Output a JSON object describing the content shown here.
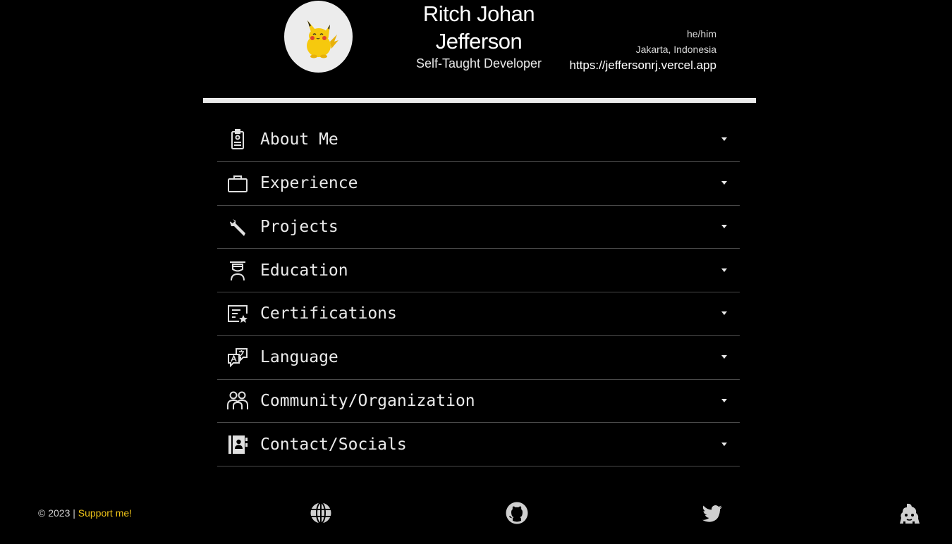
{
  "profile": {
    "name_line1": "Ritch Johan",
    "name_line2": "Jefferson",
    "role": "Self-Taught Developer",
    "pronouns": "he/him",
    "location": "Jakarta, Indonesia",
    "website": "https://jeffersonrj.vercel.app"
  },
  "sections": [
    {
      "label": "About Me",
      "icon": "id-badge-icon"
    },
    {
      "label": "Experience",
      "icon": "briefcase-icon"
    },
    {
      "label": "Projects",
      "icon": "wrench-icon"
    },
    {
      "label": "Education",
      "icon": "graduate-icon"
    },
    {
      "label": "Certifications",
      "icon": "certificate-icon"
    },
    {
      "label": "Language",
      "icon": "translate-icon"
    },
    {
      "label": "Community/Organization",
      "icon": "people-icon"
    },
    {
      "label": "Contact/Socials",
      "icon": "contact-book-icon"
    }
  ],
  "footer": {
    "copyright": "© 2023 | ",
    "support_label": "Support me!",
    "icons": [
      "globe-icon",
      "github-icon",
      "twitter-icon",
      "saweria-icon"
    ]
  },
  "colors": {
    "background": "#000000",
    "text": "#eaeaea",
    "accent": "#f0c419",
    "divider": "#4a4a4a"
  }
}
